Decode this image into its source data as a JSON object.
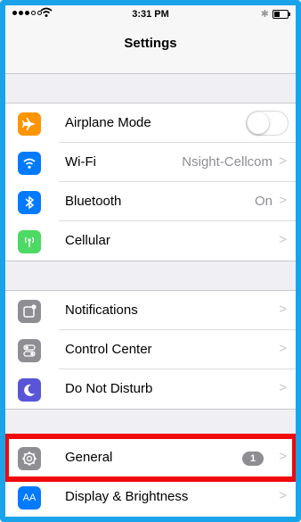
{
  "status_bar": {
    "time": "3:31 PM"
  },
  "nav": {
    "title": "Settings"
  },
  "groups": [
    {
      "rows": [
        {
          "label": "Airplane Mode",
          "icon": "airplane-icon",
          "icon_color": "#ff9500",
          "control": "toggle",
          "toggle_on": false
        },
        {
          "label": "Wi-Fi",
          "icon": "wifi-icon",
          "icon_color": "#007aff",
          "value": "Nsight-Cellcom"
        },
        {
          "label": "Bluetooth",
          "icon": "bluetooth-icon",
          "icon_color": "#007aff",
          "value": "On"
        },
        {
          "label": "Cellular",
          "icon": "cellular-icon",
          "icon_color": "#4cd964"
        }
      ]
    },
    {
      "rows": [
        {
          "label": "Notifications",
          "icon": "notifications-icon",
          "icon_color": "#8e8e93"
        },
        {
          "label": "Control Center",
          "icon": "control-center-icon",
          "icon_color": "#8e8e93"
        },
        {
          "label": "Do Not Disturb",
          "icon": "moon-icon",
          "icon_color": "#5856d6"
        }
      ]
    },
    {
      "rows": [
        {
          "label": "General",
          "icon": "gear-icon",
          "icon_color": "#8e8e93",
          "badge": "1"
        },
        {
          "label": "Display & Brightness",
          "icon": "display-icon",
          "icon_color": "#007aff",
          "icon_text": "AA"
        }
      ]
    }
  ],
  "highlight_color": "#ee0a0a"
}
